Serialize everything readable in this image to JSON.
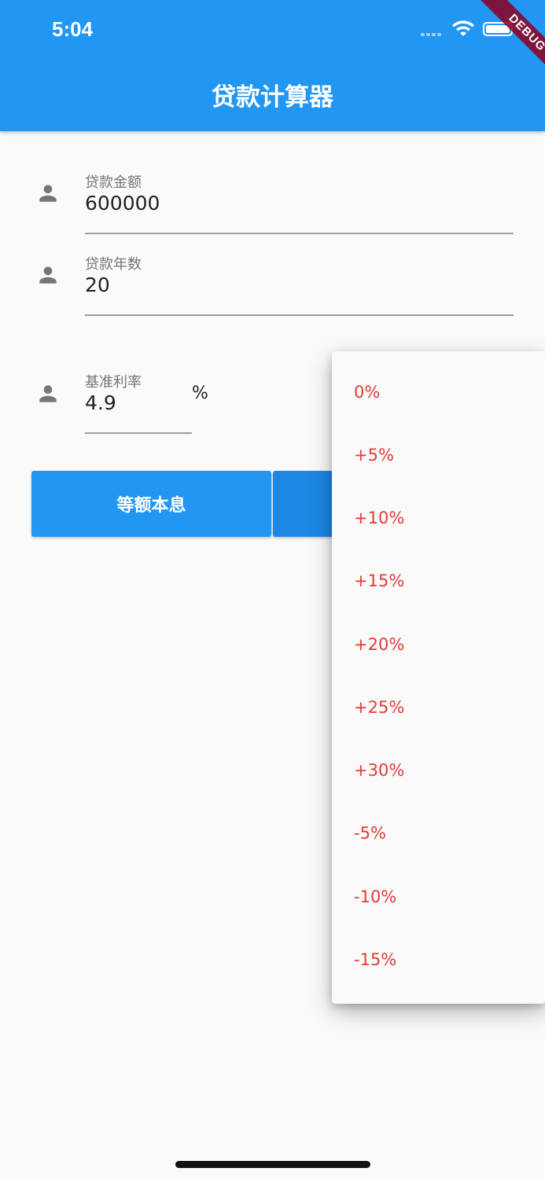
{
  "status_bar": {
    "time": "5:04",
    "debug_label": "DEBUG"
  },
  "app_bar": {
    "title": "贷款计算器",
    "color": "#2196f3"
  },
  "form": {
    "loan_amount": {
      "label": "贷款金额",
      "value": "600000",
      "icon": "person-icon"
    },
    "loan_years": {
      "label": "贷款年数",
      "value": "20",
      "icon": "person-icon"
    },
    "base_rate": {
      "label": "基准利率",
      "value": "4.9",
      "unit": "%",
      "icon": "person-icon"
    }
  },
  "buttons": {
    "equal_installment": "等额本息"
  },
  "rate_adjust_menu": {
    "item_color": "#e53935",
    "items": [
      "0%",
      "+5%",
      "+10%",
      "+15%",
      "+20%",
      "+25%",
      "+30%",
      "-5%",
      "-10%",
      "-15%"
    ]
  }
}
